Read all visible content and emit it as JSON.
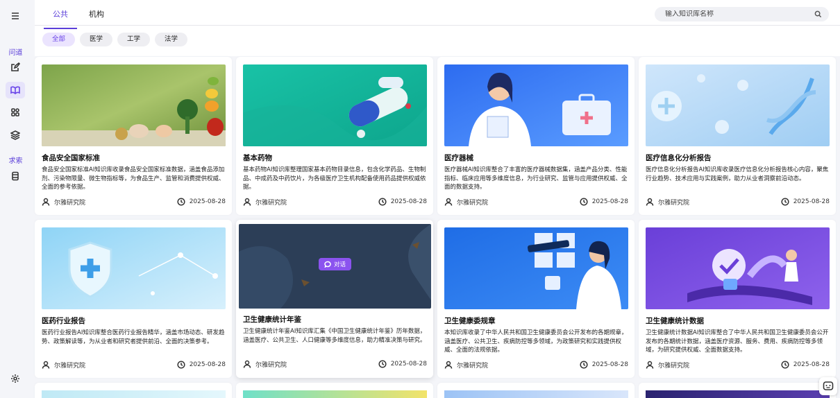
{
  "sidebar": {
    "section_ask": "问道",
    "section_seek": "求索",
    "icons": [
      "menu-icon",
      "edit-icon",
      "book-icon",
      "apps-icon",
      "layers-icon",
      "database-icon",
      "gear-icon"
    ]
  },
  "tabs": [
    {
      "label": "公共",
      "active": true
    },
    {
      "label": "机构",
      "active": false
    }
  ],
  "search": {
    "placeholder": "输入知识库名称"
  },
  "filters": [
    {
      "label": "全部",
      "active": true
    },
    {
      "label": "医学",
      "active": false
    },
    {
      "label": "工学",
      "active": false
    },
    {
      "label": "法学",
      "active": false
    }
  ],
  "cards": [
    {
      "title": "食品安全国家标准",
      "desc": "食品安全国家标准AI知识库收录食品安全国家标准数据，涵盖食品添加剂、污染物限量、微生物指标等，为食品生产、监管和消费提供权威、全面的参考依据。",
      "author": "尔雅研究院",
      "date": "2025-08-28"
    },
    {
      "title": "基本药物",
      "desc": "基本药物AI知识库整理国家基本药物目录信息，包含化学药品、生物制品、中成药及中药饮片，为各级医疗卫生机构配备使用药品提供权威依据。",
      "author": "尔雅研究院",
      "date": "2025-08-28"
    },
    {
      "title": "医疗器械",
      "desc": "医疗器械AI知识库整合了丰富的医疗器械数据集，涵盖产品分类、性能指标、临床应用等多维度信息，为行业研究、监管与应用提供权威、全面的数据支持。",
      "author": "尔雅研究院",
      "date": "2025-08-28"
    },
    {
      "title": "医疗信息化分析报告",
      "desc": "医疗信息化分析报告AI知识库收录医疗信息化分析报告核心内容，聚焦行业趋势、技术应用与实践案例，助力从业者洞察前沿动态。",
      "author": "尔雅研究院",
      "date": "2025-08-28"
    },
    {
      "title": "医药行业报告",
      "desc": "医药行业报告AI知识库整合医药行业报告精华，涵盖市场动态、研发趋势、政策解读等，为从业者和研究者提供前沿、全面的决策参考。",
      "author": "尔雅研究院",
      "date": "2025-08-28"
    },
    {
      "title": "卫生健康统计年鉴",
      "desc": "卫生健康统计年鉴AI知识库汇集《中国卫生健康统计年鉴》历年数据，涵盖医疗、公共卫生、人口健康等多维度信息，助力精准决策与研究。",
      "author": "尔雅研究院",
      "date": "2025-08-28",
      "chat_label": "对话"
    },
    {
      "title": "卫生健康委规章",
      "desc": "本知识库收录了中华人民共和国卫生健康委员会公开发布的各期规章，涵盖医疗、公共卫生、疾病防控等多领域，为政策研究和实践提供权威、全面的法规依据。",
      "author": "尔雅研究院",
      "date": "2025-08-28"
    },
    {
      "title": "卫生健康统计数据",
      "desc": "卫生健康统计数据AI知识库整合了中华人民共和国卫生健康委员会公开发布的各期统计数据，涵盖医疗资源、服务、费用、疾病防控等多领域，为研究提供权威、全面数据支持。",
      "author": "尔雅研究院",
      "date": "2025-08-28"
    }
  ],
  "colors": {
    "accent": "#5b3fd9",
    "chip_active_bg": "#ebe4fe",
    "chat_button": "#8b53ef"
  }
}
